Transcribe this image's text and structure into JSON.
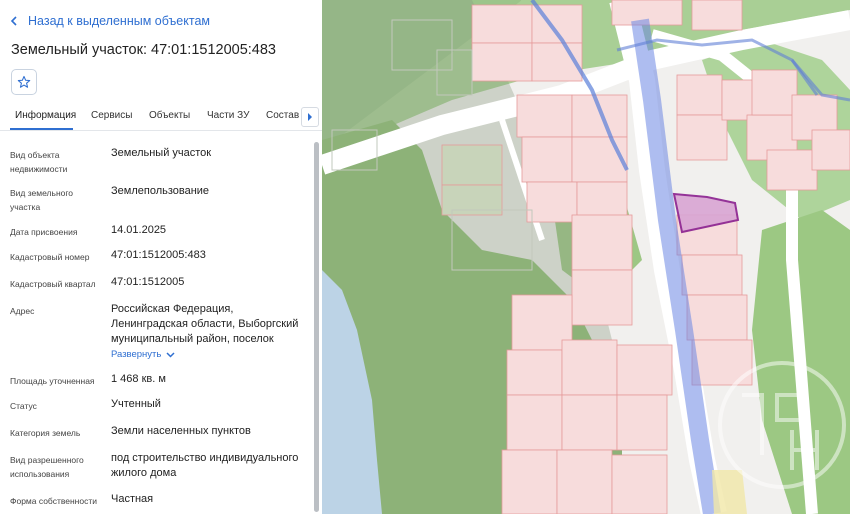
{
  "nav": {
    "back_label": "Назад к выделенным объектам"
  },
  "header": {
    "title": "Земельный участок: 47:01:1512005:483"
  },
  "tabs": [
    {
      "label": "Информация",
      "active": true
    },
    {
      "label": "Сервисы"
    },
    {
      "label": "Объекты"
    },
    {
      "label": "Части ЗУ"
    },
    {
      "label": "Состав"
    }
  ],
  "details": [
    {
      "label": "Вид объекта недвижимости",
      "value": "Земельный участок"
    },
    {
      "label": "Вид земельного участка",
      "value": "Землепользование"
    },
    {
      "label": "Дата присвоения",
      "value": "14.01.2025"
    },
    {
      "label": "Кадастровый номер",
      "value": "47:01:1512005:483"
    },
    {
      "label": "Кадастровый квартал",
      "value": "47:01:1512005"
    },
    {
      "label": "Адрес",
      "value": "Российская Федерация, Ленинградская области, Выборгский муниципальный район, поселок"
    },
    {
      "label": "Площадь уточненная",
      "value": "1 468 кв. м"
    },
    {
      "label": "Статус",
      "value": "Учтенный"
    },
    {
      "label": "Категория земель",
      "value": "Земли населенных пунктов"
    },
    {
      "label": "Вид разрешенного использования",
      "value": "под строительство индивидуального жилого дома"
    },
    {
      "label": "Форма собственности",
      "value": "Частная"
    }
  ],
  "expand_label": "Развернуть",
  "colors": {
    "accent": "#2f6fd1",
    "parcel_highlight": "#8a1f8f",
    "parcel_fill": "#f7dcdc",
    "green": "#8fbf73"
  },
  "icons": [
    "chevron-left-icon",
    "star-icon",
    "chevron-right-icon",
    "chevron-down-icon",
    "watermark-logo"
  ]
}
